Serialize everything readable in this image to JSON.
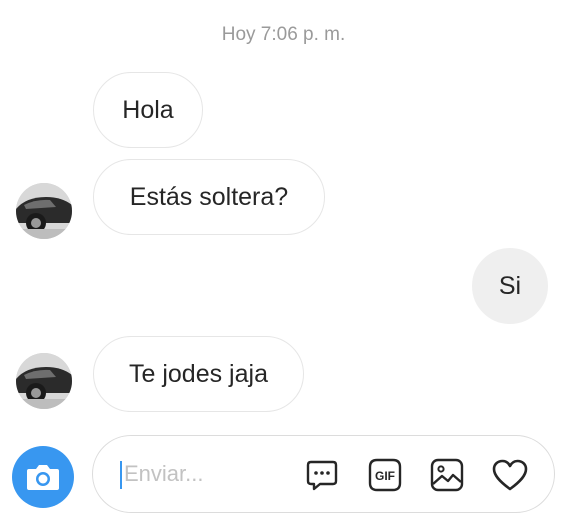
{
  "thread": {
    "timestamp": "Hoy 7:06 p. m.",
    "messages": [
      {
        "text": "Hola",
        "direction": "incoming"
      },
      {
        "text": "Estás soltera?",
        "direction": "incoming"
      },
      {
        "text": "Si",
        "direction": "outgoing"
      },
      {
        "text": "Te jodes jaja",
        "direction": "incoming"
      }
    ]
  },
  "composer": {
    "placeholder": "Enviar..."
  },
  "colors": {
    "accent": "#3897f0",
    "incoming_bubble_border": "#e6e6e6",
    "outgoing_bubble": "#efefef"
  },
  "icons": [
    "camera-icon",
    "quick-reply-icon",
    "gif-icon",
    "gallery-icon",
    "heart-icon"
  ]
}
